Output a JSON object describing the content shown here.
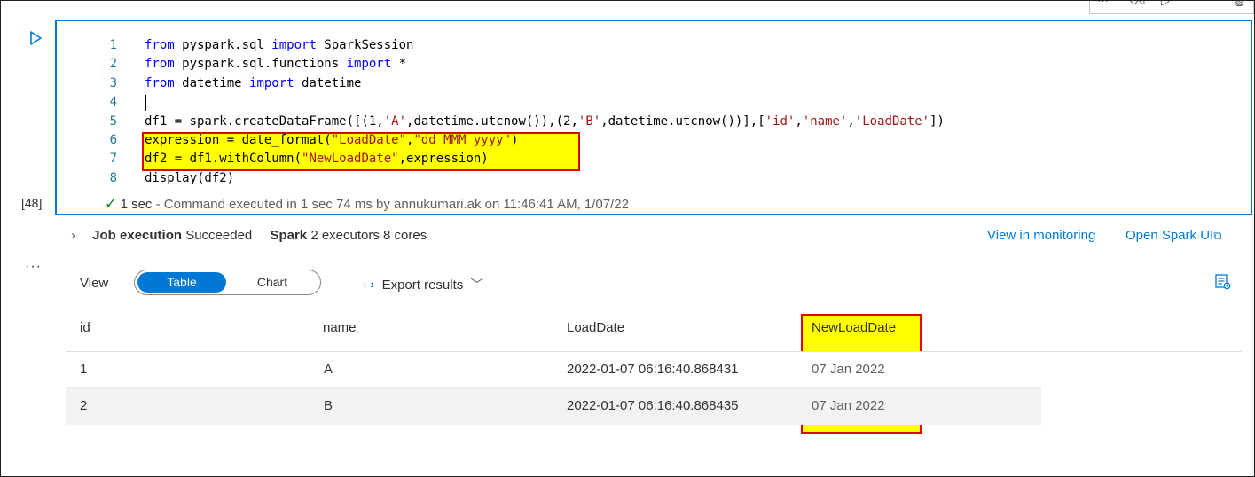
{
  "cell": {
    "execution_count": "[48]",
    "more_label": "···",
    "lines": [
      {
        "n": "1",
        "parts": [
          {
            "t": "from",
            "c": "kw"
          },
          {
            "t": " pyspark.sql ",
            "c": ""
          },
          {
            "t": "import",
            "c": "kw"
          },
          {
            "t": " SparkSession",
            "c": ""
          }
        ]
      },
      {
        "n": "2",
        "parts": [
          {
            "t": "from",
            "c": "kw"
          },
          {
            "t": " pyspark.sql.functions ",
            "c": ""
          },
          {
            "t": "import",
            "c": "kw"
          },
          {
            "t": " *",
            "c": ""
          }
        ]
      },
      {
        "n": "3",
        "parts": [
          {
            "t": "from",
            "c": "kw"
          },
          {
            "t": " datetime ",
            "c": ""
          },
          {
            "t": "import",
            "c": "kw"
          },
          {
            "t": " datetime",
            "c": ""
          }
        ]
      },
      {
        "n": "4",
        "parts": []
      },
      {
        "n": "5",
        "parts": [
          {
            "t": "df1 = spark.createDataFrame([(1,",
            "c": ""
          },
          {
            "t": "'A'",
            "c": "str"
          },
          {
            "t": ",datetime.utcnow()),(2,",
            "c": ""
          },
          {
            "t": "'B'",
            "c": "str"
          },
          {
            "t": ",datetime.utcnow())],[",
            "c": ""
          },
          {
            "t": "'id'",
            "c": "str"
          },
          {
            "t": ",",
            "c": ""
          },
          {
            "t": "'name'",
            "c": "str"
          },
          {
            "t": ",",
            "c": ""
          },
          {
            "t": "'LoadDate'",
            "c": "str"
          },
          {
            "t": "])",
            "c": ""
          }
        ]
      },
      {
        "n": "6",
        "parts": [
          {
            "t": "expression = date_format(",
            "c": ""
          },
          {
            "t": "\"LoadDate\"",
            "c": "str"
          },
          {
            "t": ",",
            "c": ""
          },
          {
            "t": "\"dd MMM yyyy\"",
            "c": "str"
          },
          {
            "t": ")",
            "c": ""
          }
        ]
      },
      {
        "n": "7",
        "parts": [
          {
            "t": "df2 = df1.withColumn(",
            "c": ""
          },
          {
            "t": "\"NewLoadDate\"",
            "c": "str"
          },
          {
            "t": ",expression)",
            "c": ""
          }
        ]
      },
      {
        "n": "8",
        "parts": [
          {
            "t": "display(df2)",
            "c": ""
          }
        ]
      }
    ],
    "status": {
      "duration": "1 sec",
      "message": " - Command executed in 1 sec 74 ms by annukumari.ak on 11:46:41 AM, 1/07/22"
    }
  },
  "output": {
    "job_label": "Job execution",
    "job_status": "Succeeded",
    "spark_label": "Spark",
    "spark_info": "2 executors 8 cores",
    "view_in_monitoring": "View in monitoring",
    "open_spark_ui": "Open Spark UI",
    "view_label": "View",
    "view_options": [
      "Table",
      "Chart"
    ],
    "export_label": "Export results"
  },
  "table": {
    "columns": [
      "id",
      "name",
      "LoadDate",
      "NewLoadDate"
    ],
    "rows": [
      [
        "1",
        "A",
        "2022-01-07 06:16:40.868431",
        "07 Jan 2022"
      ],
      [
        "2",
        "B",
        "2022-01-07 06:16:40.868435",
        "07 Jan 2022"
      ]
    ]
  },
  "colors": {
    "accent": "#0078d4",
    "highlight": "#ffff00",
    "highlight_border": "#e00000",
    "success": "#107c10"
  }
}
